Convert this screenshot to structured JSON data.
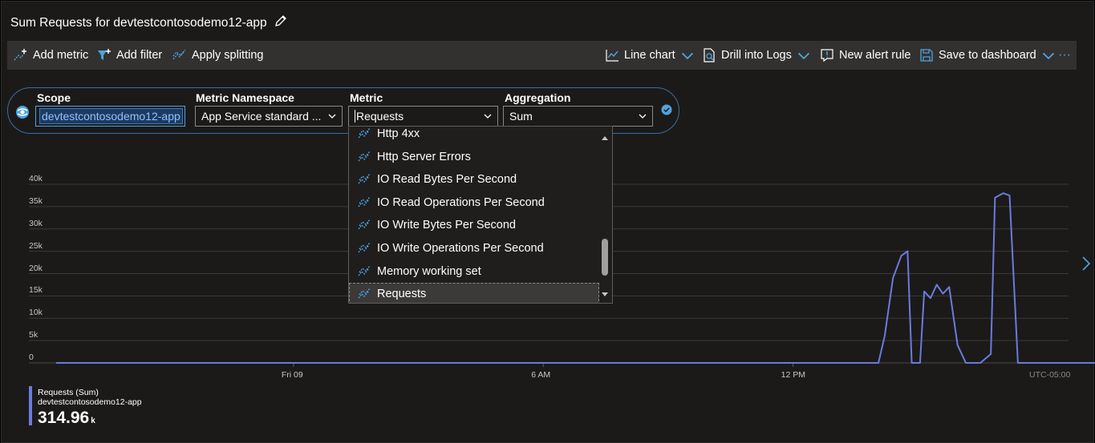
{
  "header": {
    "title": "Sum Requests for devtestcontosodemo12-app"
  },
  "toolbar": {
    "add_metric": "Add metric",
    "add_filter": "Add filter",
    "apply_splitting": "Apply splitting",
    "line_chart": "Line chart",
    "drill_logs": "Drill into Logs",
    "new_alert": "New alert rule",
    "save_dashboard": "Save to dashboard",
    "more": "···"
  },
  "selector": {
    "scope_label": "Scope",
    "scope_value": "devtestcontosodemo12-app",
    "namespace_label": "Metric Namespace",
    "namespace_value": "App Service standard ...",
    "metric_label": "Metric",
    "metric_value": "Requests",
    "aggregation_label": "Aggregation",
    "aggregation_value": "Sum"
  },
  "metric_menu": {
    "items": [
      "Http 4xx",
      "Http Server Errors",
      "IO Read Bytes Per Second",
      "IO Read Operations Per Second",
      "IO Write Bytes Per Second",
      "IO Write Operations Per Second",
      "Memory working set",
      "Requests"
    ],
    "selected": "Requests"
  },
  "chart_data": {
    "type": "line",
    "y_ticks": [
      "40k",
      "35k",
      "30k",
      "25k",
      "20k",
      "15k",
      "10k",
      "5k",
      "0"
    ],
    "ylim": [
      0,
      40000
    ],
    "x_ticks": [
      "Fri 09",
      "6 AM",
      "12 PM"
    ],
    "timezone": "UTC-05:00",
    "grid": true,
    "series": [
      {
        "name": "Requests (Sum)",
        "color": "#6b7bdc",
        "x_hours": [
          0,
          19.5,
          19.75,
          19.9,
          20.1,
          20.3,
          20.45,
          20.55,
          20.75,
          20.85,
          21.0,
          21.15,
          21.3,
          21.45,
          21.65,
          21.85,
          22.2,
          22.45,
          22.55,
          22.75,
          22.9,
          23.1,
          23.25,
          23.5,
          25.5
        ],
        "values": [
          0,
          0,
          0,
          6000,
          19000,
          24000,
          25000,
          0,
          0,
          16000,
          14500,
          17500,
          15500,
          17000,
          4000,
          0,
          0,
          2000,
          37000,
          38000,
          37500,
          0,
          0,
          0,
          0
        ]
      }
    ]
  },
  "legend": {
    "name": "Requests (Sum)",
    "resource": "devtestcontosodemo12-app",
    "value": "314.96",
    "unit": "k"
  }
}
